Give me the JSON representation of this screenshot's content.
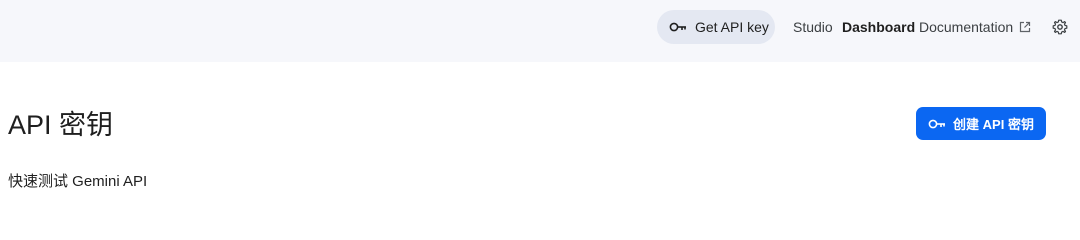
{
  "header": {
    "get_api_key_label": "Get API key",
    "key_icon": "key-icon",
    "nav": {
      "studio": "Studio",
      "dashboard": "Dashboard",
      "documentation": "Documentation"
    },
    "external_link_icon": "external-link-icon",
    "settings_icon": "gear-icon"
  },
  "main": {
    "title": "API 密钥",
    "create_button_label": "创建 API 密钥",
    "subtitle": "快速测试 Gemini API"
  },
  "colors": {
    "topbar_bg": "#f6f7fb",
    "get_key_pill_bg": "#e4e8f2",
    "primary_blue": "#0b67f2",
    "text_dark": "#1f1f1f"
  }
}
